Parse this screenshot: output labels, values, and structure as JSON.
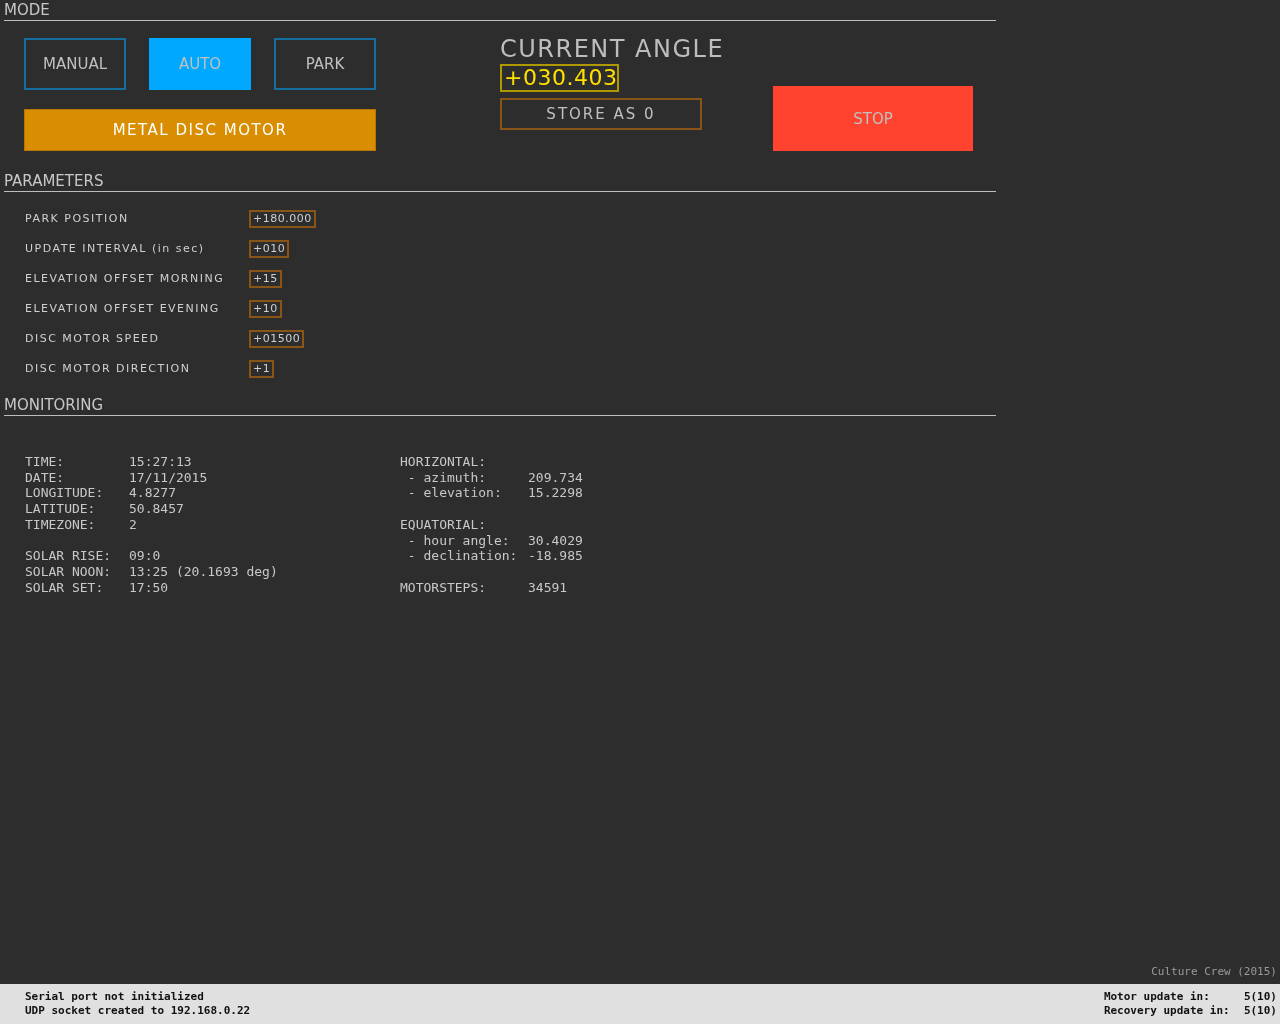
{
  "mode": {
    "title": "MODE",
    "buttons": [
      {
        "label": "MANUAL",
        "selected": false
      },
      {
        "label": "AUTO",
        "selected": true
      },
      {
        "label": "PARK",
        "selected": false
      }
    ],
    "motor_button": "METAL DISC MOTOR",
    "angle": {
      "title": "CURRENT ANGLE",
      "value": "+030.403",
      "store_button": "STORE AS 0"
    },
    "stop_button": "STOP"
  },
  "parameters": {
    "title": "PARAMETERS",
    "rows": [
      {
        "label": "PARK POSITION",
        "value": "+180.000"
      },
      {
        "label": "UPDATE INTERVAL (in sec)",
        "value": "+010"
      },
      {
        "label": "ELEVATION OFFSET MORNING",
        "value": "+15"
      },
      {
        "label": "ELEVATION OFFSET EVENING",
        "value": "+10"
      },
      {
        "label": "DISC MOTOR SPEED",
        "value": "+01500"
      },
      {
        "label": "DISC MOTOR DIRECTION",
        "value": "+1"
      }
    ]
  },
  "monitoring": {
    "title": "MONITORING",
    "left_groups": [
      {
        "rows": [
          {
            "label": "TIME:",
            "value": "15:27:13"
          },
          {
            "label": "DATE:",
            "value": "17/11/2015"
          },
          {
            "label": "LONGITUDE:",
            "value": "4.8277"
          },
          {
            "label": "LATITUDE:",
            "value": "50.8457"
          },
          {
            "label": "TIMEZONE:",
            "value": "2"
          }
        ]
      },
      {
        "rows": [
          {
            "label": "SOLAR RISE:",
            "value": "09:0"
          },
          {
            "label": "SOLAR NOON:",
            "value": "13:25 (20.1693 deg)"
          },
          {
            "label": "SOLAR SET:",
            "value": "17:50"
          }
        ]
      }
    ],
    "right_groups": [
      {
        "heading": "HORIZONTAL:",
        "rows": [
          {
            "label": " - azimuth:",
            "value": "209.734"
          },
          {
            "label": " - elevation:",
            "value": "15.2298"
          }
        ]
      },
      {
        "heading": "EQUATORIAL:",
        "rows": [
          {
            "label": " - hour angle:",
            "value": "30.4029"
          },
          {
            "label": " - declination:",
            "value": "-18.985"
          }
        ]
      },
      {
        "rows": [
          {
            "label": "MOTORSTEPS:",
            "value": "34591"
          }
        ]
      }
    ]
  },
  "credit": "Culture Crew (2015)",
  "status_bar": {
    "messages": [
      "Serial port not initialized",
      "UDP socket created to 192.168.0.22"
    ],
    "counters": [
      {
        "label": "Motor update in:",
        "value": "5(10)"
      },
      {
        "label": "Recovery update in:",
        "value": "5(10)"
      }
    ]
  }
}
